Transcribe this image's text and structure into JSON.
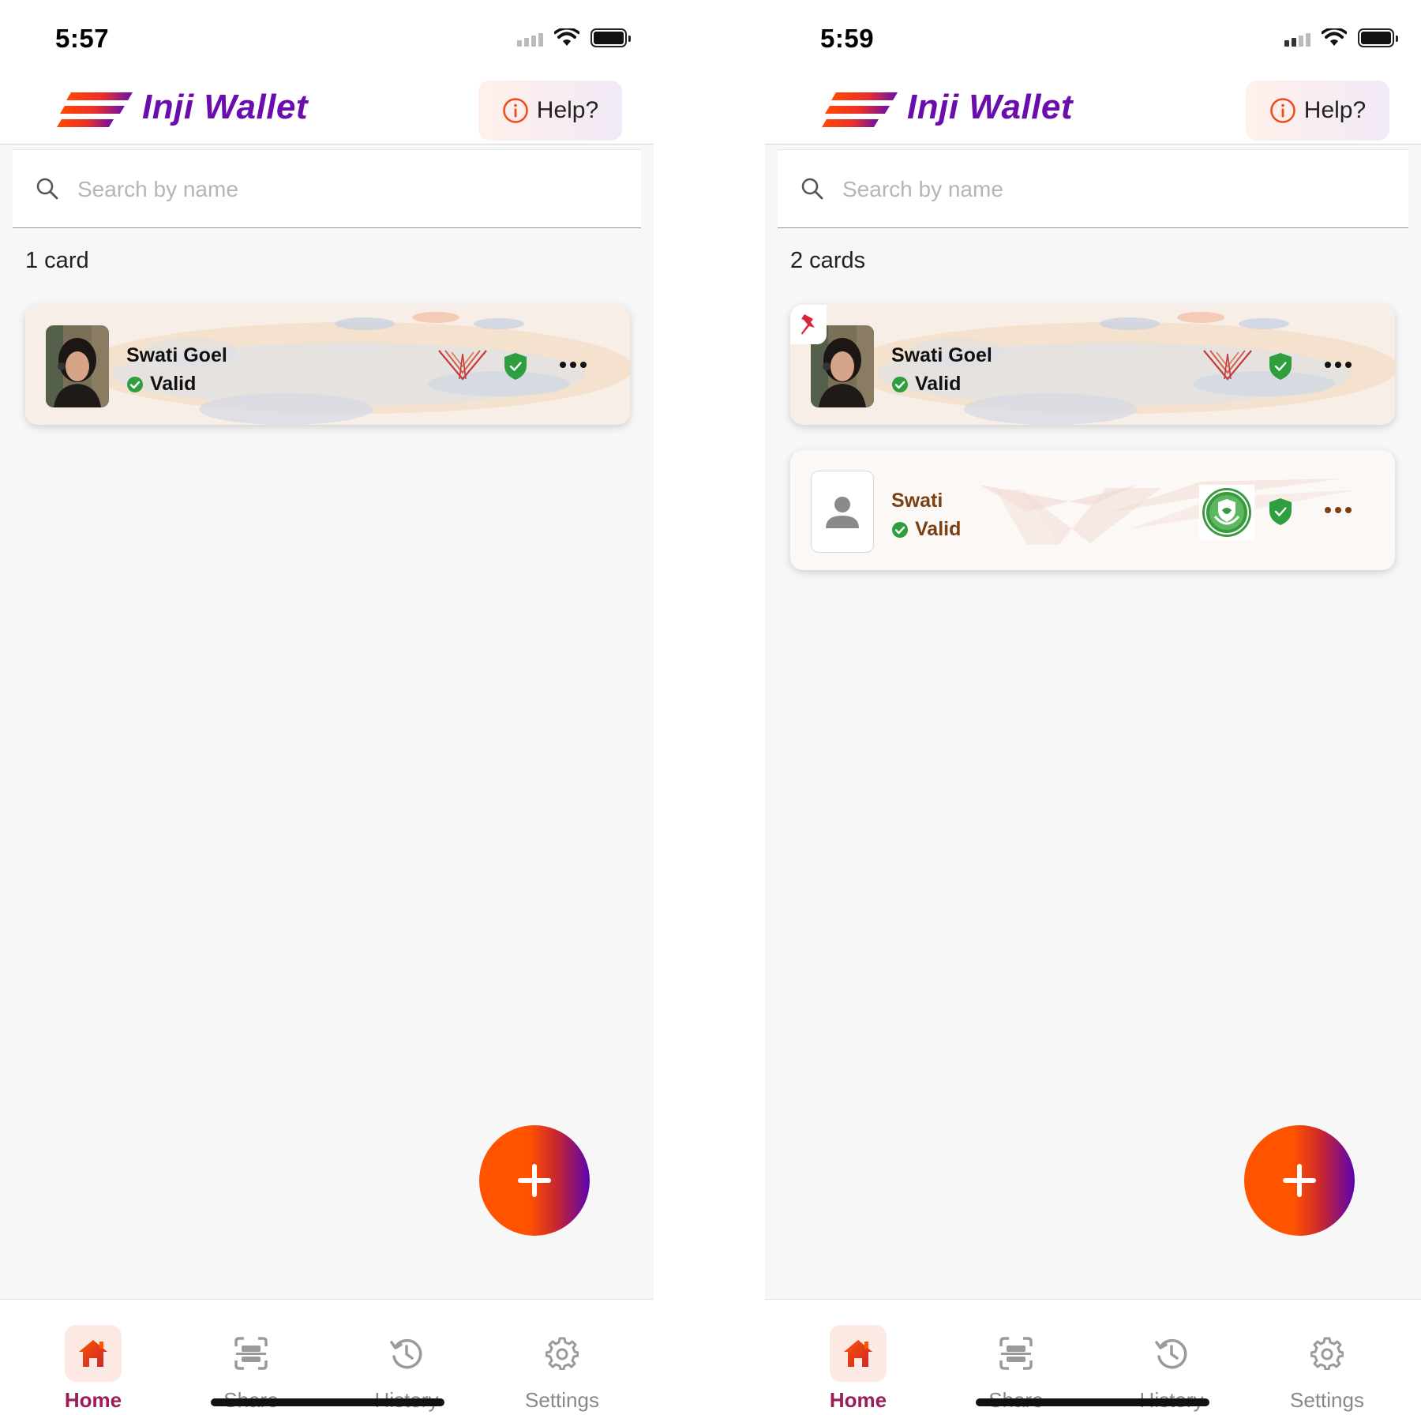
{
  "colors": {
    "brand_purple": "#6a0dad",
    "brand_orange": "#ff5300",
    "valid_green": "#2e9e3e",
    "nav_active": "#9a1f56"
  },
  "screens": [
    {
      "status_time": "5:57",
      "app_title": "Inji Wallet",
      "help_label": "Help?",
      "search_placeholder": "Search by name",
      "card_count": "1 card",
      "cards": [
        {
          "name": "Swati Goel",
          "status": "Valid",
          "pinned": false,
          "issuer_icon": "mosip-logo-icon"
        }
      ],
      "nav": [
        {
          "label": "Home",
          "icon": "home-icon",
          "active": true
        },
        {
          "label": "Share",
          "icon": "scan-icon",
          "active": false
        },
        {
          "label": "History",
          "icon": "history-icon",
          "active": false
        },
        {
          "label": "Settings",
          "icon": "gear-icon",
          "active": false
        }
      ]
    },
    {
      "status_time": "5:59",
      "app_title": "Inji Wallet",
      "help_label": "Help?",
      "search_placeholder": "Search by name",
      "card_count": "2 cards",
      "cards": [
        {
          "name": "Swati Goel",
          "status": "Valid",
          "pinned": true,
          "issuer_icon": "mosip-logo-icon"
        },
        {
          "name": "Swati",
          "status": "Valid",
          "pinned": false,
          "issuer_icon": "green-issuer-logo-icon"
        }
      ],
      "nav": [
        {
          "label": "Home",
          "icon": "home-icon",
          "active": true
        },
        {
          "label": "Share",
          "icon": "scan-icon",
          "active": false
        },
        {
          "label": "History",
          "icon": "history-icon",
          "active": false
        },
        {
          "label": "Settings",
          "icon": "gear-icon",
          "active": false
        }
      ]
    }
  ]
}
